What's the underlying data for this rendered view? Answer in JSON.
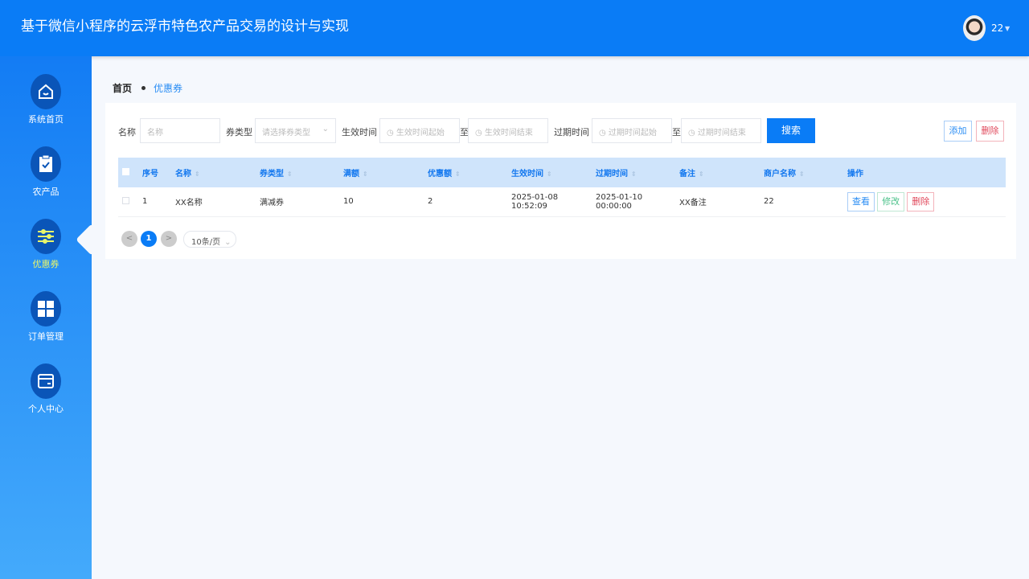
{
  "header": {
    "title": "基于微信小程序的云浮市特色农产品交易的设计与实现",
    "username": "22"
  },
  "sidebar": {
    "items": [
      {
        "label": "系统首页",
        "icon": "home-icon"
      },
      {
        "label": "农产品",
        "icon": "clipboard-check-icon"
      },
      {
        "label": "优惠券",
        "icon": "sliders-icon",
        "active": true
      },
      {
        "label": "订单管理",
        "icon": "grid-icon"
      },
      {
        "label": "个人中心",
        "icon": "card-icon"
      }
    ]
  },
  "breadcrumb": {
    "home": "首页",
    "current": "优惠券"
  },
  "filters": {
    "name_label": "名称",
    "name_placeholder": "名称",
    "type_label": "券类型",
    "type_placeholder": "请选择券类型",
    "effective_label": "生效时间",
    "effective_start": "生效时间起始",
    "effective_end": "生效时间结束",
    "expire_label": "过期时间",
    "expire_start": "过期时间起始",
    "expire_end": "过期时间结束",
    "to": "至",
    "search": "搜索",
    "add": "添加",
    "delete": "删除"
  },
  "table": {
    "columns": [
      "序号",
      "名称",
      "券类型",
      "满额",
      "优惠额",
      "生效时间",
      "过期时间",
      "备注",
      "商户名称",
      "操作"
    ],
    "rows": [
      {
        "index": "1",
        "name": "XX名称",
        "type": "满减券",
        "threshold": "10",
        "discount": "2",
        "effective": "2025-01-08 10:52:09",
        "expire": "2025-01-10 00:00:00",
        "remark": "XX备注",
        "merchant": "22"
      }
    ],
    "actions": {
      "view": "查看",
      "edit": "修改",
      "delete": "删除"
    }
  },
  "pagination": {
    "prev": "<",
    "page": "1",
    "next": ">",
    "page_size": "10条/页"
  },
  "colors": {
    "primary": "#0a7cf6",
    "active_nav": "#e8f56a",
    "danger": "#e0475a",
    "success": "#4cc28a"
  }
}
